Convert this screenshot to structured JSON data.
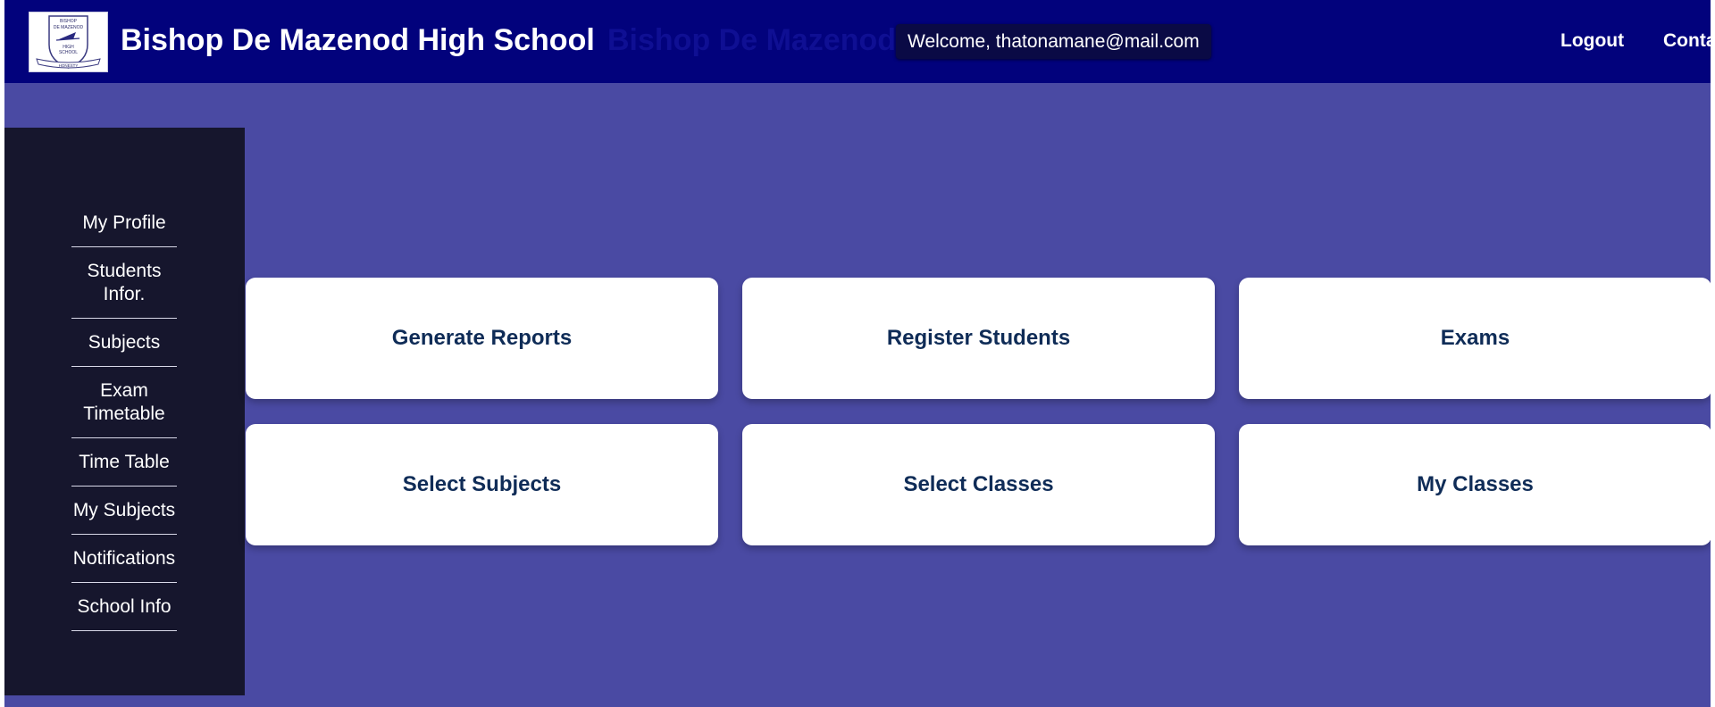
{
  "header": {
    "title": "Bishop De Mazenod High School",
    "title_ghost": "Bishop De Mazenod",
    "welcome": "Welcome, thatonamane@mail.com",
    "logout": "Logout",
    "contact": "Conta",
    "logo": {
      "line1": "BISHOP",
      "line2": "DE MAZENOD",
      "line3": "HIGH",
      "line4": "SCHOOL",
      "motto": "HONESTY"
    }
  },
  "sidebar": {
    "items": [
      {
        "label": "My Profile"
      },
      {
        "label": "Students Infor."
      },
      {
        "label": "Subjects"
      },
      {
        "label": "Exam Timetable"
      },
      {
        "label": "Time Table"
      },
      {
        "label": "My Subjects"
      },
      {
        "label": "Notifications"
      },
      {
        "label": "School Info"
      }
    ]
  },
  "cards": [
    {
      "label": "Generate Reports"
    },
    {
      "label": "Register Students"
    },
    {
      "label": "Exams"
    },
    {
      "label": "Select Subjects"
    },
    {
      "label": "Select Classes"
    },
    {
      "label": "My Classes"
    }
  ],
  "colors": {
    "header_bg": "#02027c",
    "page_bg": "#4a4aa3",
    "sidebar_bg": "#16162d",
    "card_text": "#0f2c57"
  }
}
